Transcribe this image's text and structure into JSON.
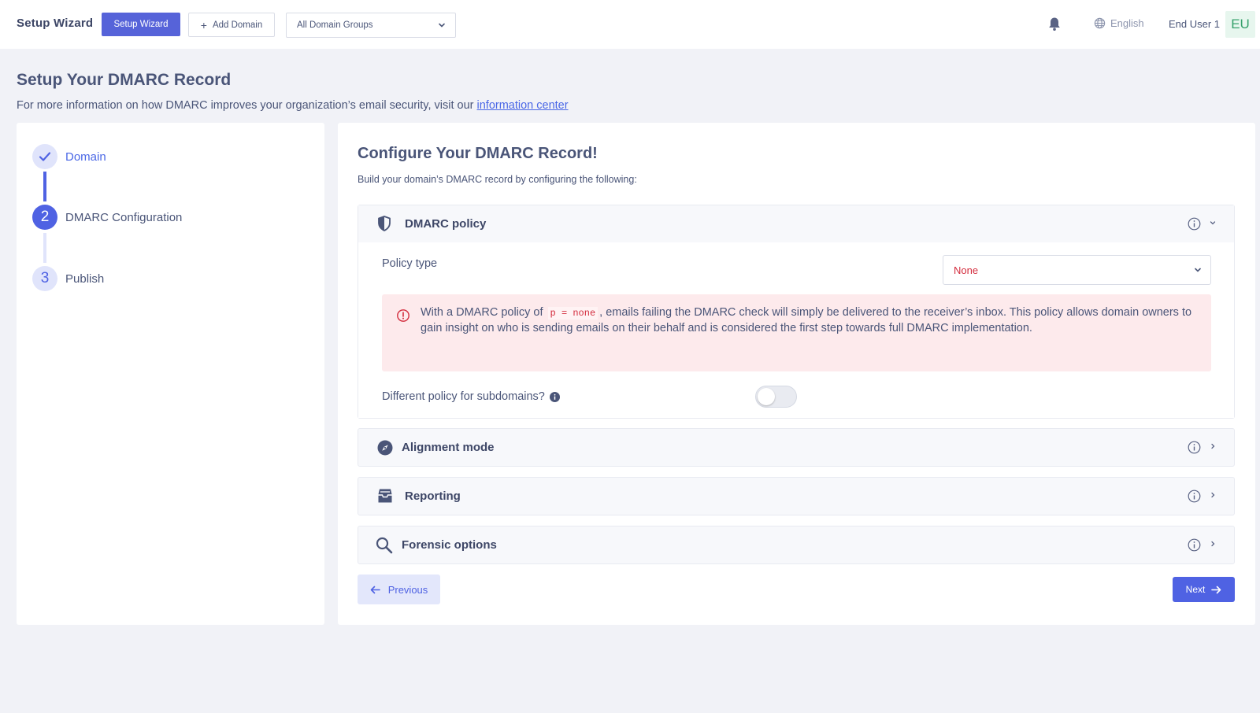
{
  "topbar": {
    "app_title": "Setup Wizard",
    "setup_wizard_button": "Setup Wizard",
    "add_domain_button": "Add Domain",
    "domain_group_select": "All Domain Groups",
    "language": "English",
    "user_name": "End User 1",
    "avatar_initials": "EU"
  },
  "header": {
    "title": "Setup Your DMARC Record",
    "subtitle": "For more information on how DMARC improves your organization’s email security, visit our",
    "link_text": "information center"
  },
  "steps": [
    {
      "number": "1",
      "label": "Domain",
      "state": "complete"
    },
    {
      "number": "2",
      "label": "DMARC Configuration",
      "state": "active"
    },
    {
      "number": "3",
      "label": "Publish",
      "state": "pending"
    }
  ],
  "main": {
    "title": "Configure Your DMARC Record!",
    "subtitle": "Build your domain’s DMARC record by configuring the following:",
    "sections": {
      "policy": {
        "title": "DMARC policy",
        "policy_type_label": "Policy type",
        "policy_type_value": "None",
        "alert_prefix": "With a DMARC policy of",
        "alert_code": "p = none",
        "alert_suffix": ", emails failing the DMARC check will simply be delivered to the receiver’s inbox. This policy allows domain owners to gain insight on who is sending emails on their behalf and is considered the first step towards full DMARC implementation.",
        "subdomain_label": "Different policy for subdomains?",
        "subdomain_toggle_on": false
      },
      "alignment": {
        "title": "Alignment mode"
      },
      "reporting": {
        "title": "Reporting"
      },
      "forensic": {
        "title": "Forensic options"
      }
    },
    "previous_button": "Previous",
    "next_button": "Next"
  },
  "colors": {
    "primary": "#4f62e3",
    "error": "#d32c3d",
    "alert_bg": "#fdeaec",
    "avatar_bg": "#e7f6ee",
    "avatar_fg": "#35a06b"
  },
  "icons": {
    "bell": "bell-icon",
    "globe": "globe-icon",
    "shield": "shield-icon",
    "compass": "compass-icon",
    "inbox": "inbox-icon",
    "search": "search-icon"
  }
}
